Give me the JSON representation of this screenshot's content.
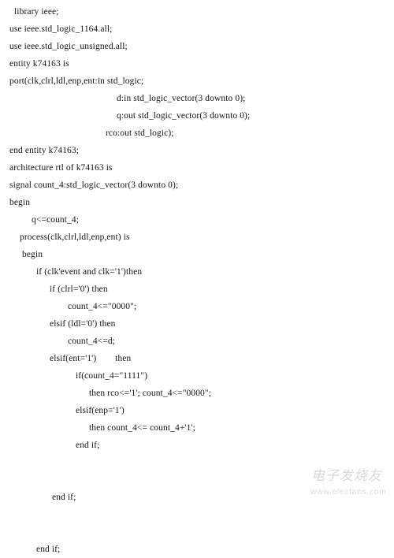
{
  "document": {
    "language": "VHDL",
    "entity_name": "k74163",
    "text_color": "#151515",
    "background_color": "#ffffff",
    "lines": [
      {
        "indent": 18,
        "text": "library ieee;"
      },
      {
        "indent": 12,
        "text": "use ieee.std_logic_1164.all;"
      },
      {
        "indent": 12,
        "text": "use ieee.std_logic_unsigned.all;"
      },
      {
        "indent": 12,
        "text": "entity k74163 is"
      },
      {
        "indent": 12,
        "text": "port(clk,clrl,ldl,enp,ent:in std_logic;"
      },
      {
        "indent": 148,
        "text": "d:in std_logic_vector(3 downto 0);"
      },
      {
        "indent": 148,
        "text": "q:out std_logic_vector(3 downto 0);"
      },
      {
        "indent": 134,
        "text": "rco:out std_logic);"
      },
      {
        "indent": 12,
        "text": "end entity k74163;"
      },
      {
        "indent": 12,
        "text": "architecture rtl of k74163 is"
      },
      {
        "indent": 12,
        "text": "signal count_4:std_logic_vector(3 downto 0);"
      },
      {
        "indent": 12,
        "text": "begin"
      },
      {
        "indent": 40,
        "text": "q<=count_4;"
      },
      {
        "indent": 25,
        "text": "process(clk,clrl,ldl,enp,ent) is"
      },
      {
        "indent": 28,
        "text": "begin"
      },
      {
        "indent": 46,
        "text": "if (clk'event and clk='1')then"
      },
      {
        "indent": 63,
        "text": "if (clrl='0') then"
      },
      {
        "indent": 86,
        "text": "count_4<=\"0000\";"
      },
      {
        "indent": 63,
        "text": "elsif (ldl='0') then"
      },
      {
        "indent": 86,
        "text": "count_4<=d;"
      },
      {
        "indent": 63,
        "text": "elsif(ent='1')        then"
      },
      {
        "indent": 96,
        "text": "if(count_4=\"1111\")"
      },
      {
        "indent": 113,
        "text": "then rco<='1'; count_4<=\"0000\";"
      },
      {
        "indent": 96,
        "text": "elsif(enp='1')"
      },
      {
        "indent": 113,
        "text": "then count_4<= count_4+'1';"
      },
      {
        "indent": 96,
        "text": "end if;"
      },
      {
        "indent": 0,
        "text": ""
      },
      {
        "indent": 0,
        "text": ""
      },
      {
        "indent": 66,
        "text": "end if;"
      },
      {
        "indent": 0,
        "text": ""
      },
      {
        "indent": 0,
        "text": ""
      },
      {
        "indent": 46,
        "text": "end if;"
      }
    ]
  },
  "watermark": {
    "brand_cn": "电子发烧友",
    "url": "www.elecfans.com",
    "color": "#dcdcdc"
  }
}
